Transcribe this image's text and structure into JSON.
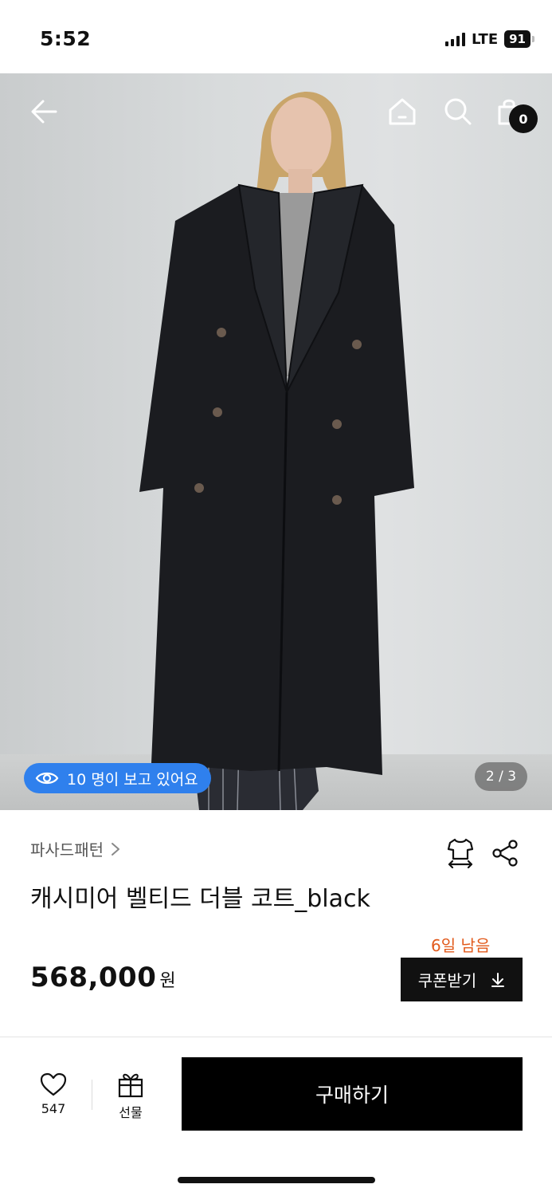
{
  "status_bar": {
    "time": "5:52",
    "network": "LTE",
    "battery": "91"
  },
  "header": {
    "back_icon": "arrow-left-icon",
    "home_icon": "home-icon",
    "search_icon": "search-icon",
    "cart_icon": "shopping-bag-icon",
    "cart_count": "0"
  },
  "hero": {
    "viewers_text": "10 명이 보고 있어요",
    "viewers_icon": "eye-icon",
    "page_indicator": "2 / 3",
    "accent_color": "#2f80ed"
  },
  "product": {
    "brand": "파사드패턴",
    "title": "캐시미어 벨티드 더블 코트_black",
    "days_left": "6일 남음",
    "price": "568,000",
    "price_unit": "원",
    "coupon_label": "쿠폰받기",
    "size_icon": "size-guide-icon",
    "share_icon": "share-icon",
    "days_left_color": "#e25a1c"
  },
  "bottom_bar": {
    "like_count": "547",
    "gift_label": "선물",
    "buy_label": "구매하기"
  }
}
